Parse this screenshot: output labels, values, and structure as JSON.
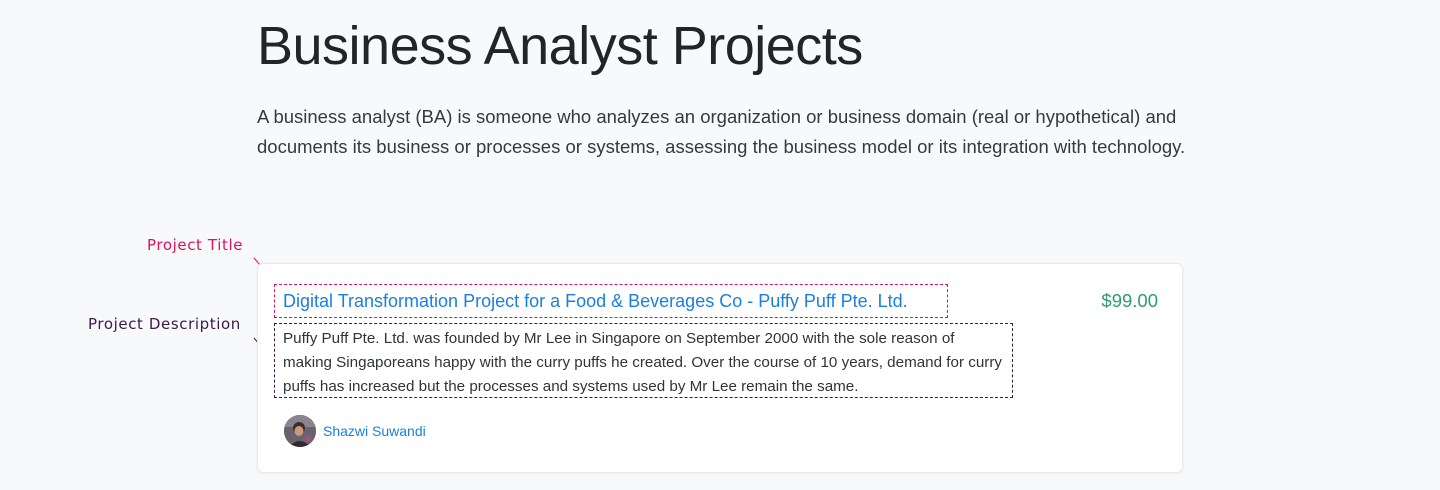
{
  "header": {
    "title": "Business Analyst Projects",
    "intro": "A business analyst (BA) is someone who analyzes an organization or business domain (real or hypothetical) and documents its business or processes or systems, assessing the business model or its integration with technology."
  },
  "annotations": {
    "title_label": "Project Title",
    "description_label": "Project Description"
  },
  "project": {
    "title": "Digital Transformation Project for a Food & Beverages Co - Puffy Puff Pte. Ltd.",
    "description": "Puffy Puff Pte. Ltd. was founded by Mr Lee in Singapore on September 2000 with the sole reason of making Singaporeans happy with the curry puffs he created. Over the course of 10 years, demand for curry puffs has increased but the processes and systems used by Mr Lee remain the same.",
    "price": "$99.00",
    "author": "Shazwi Suwandi",
    "author_icon": "avatar-photo"
  },
  "colors": {
    "link": "#1a7fe0",
    "price": "#2e9e6a",
    "title_annotation": "#e0115f",
    "description_annotation": "#3b1a4a"
  }
}
